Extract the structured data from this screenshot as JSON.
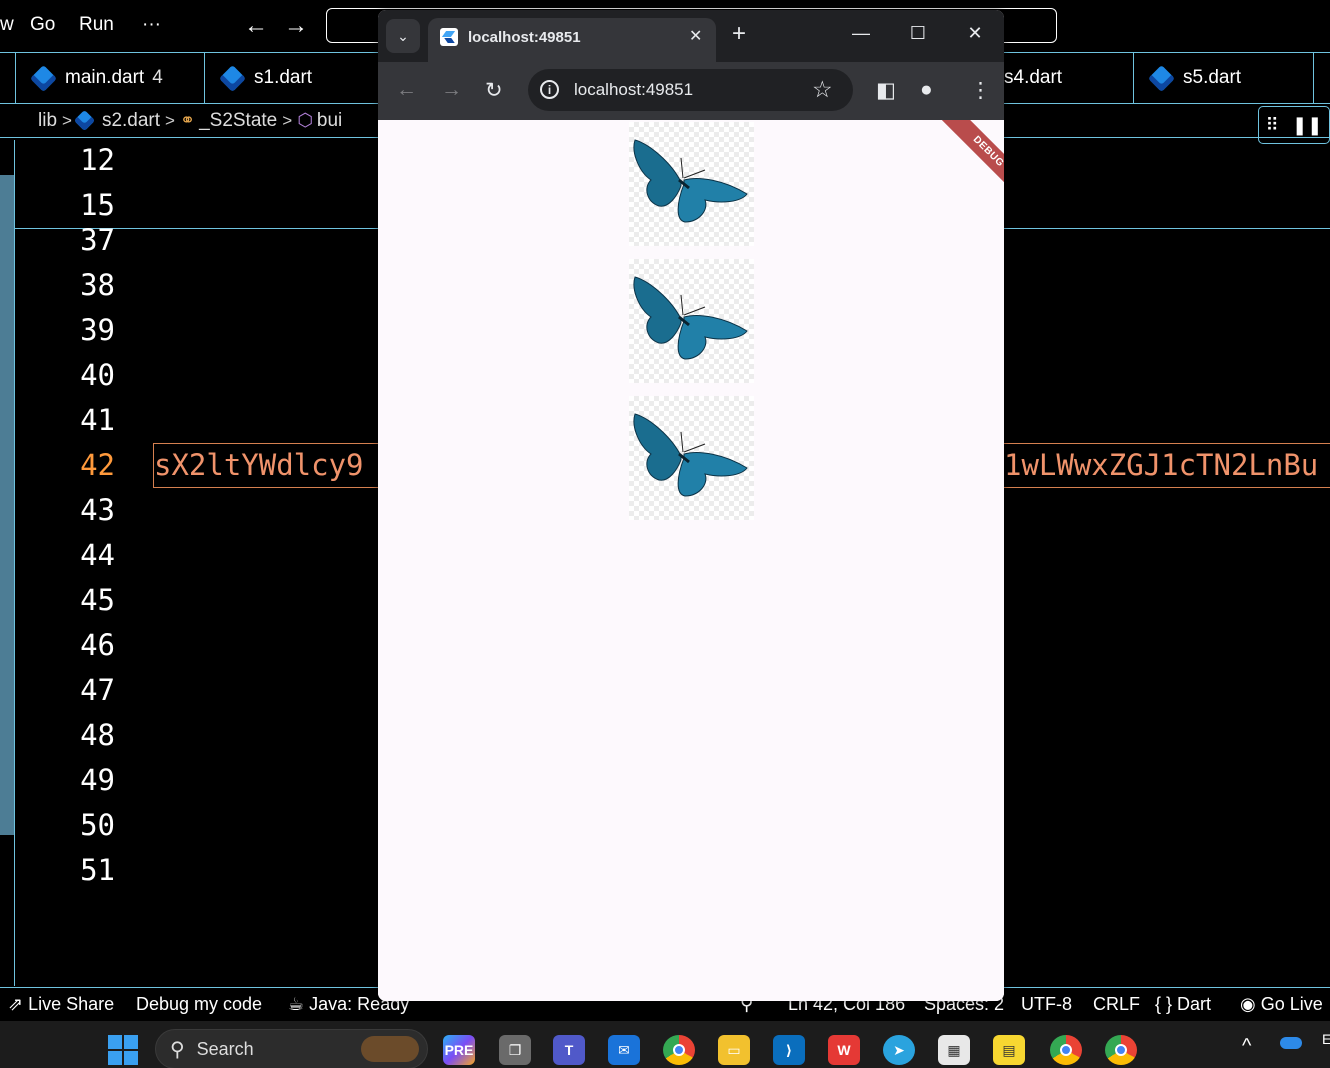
{
  "menubar": {
    "edge_letter": "w",
    "items": [
      "Go",
      "Run",
      "···"
    ],
    "back_arrow": "←",
    "forward_arrow": "→"
  },
  "tabs": [
    {
      "label": "main.dart",
      "badge": "4"
    },
    {
      "label": "s1.dart"
    },
    {
      "label": "s4.dart"
    },
    {
      "label": "s5.dart"
    }
  ],
  "breadcrumb": {
    "items": [
      "lib",
      "s2.dart",
      "_S2State",
      "bui"
    ]
  },
  "editor": {
    "sticky_lines": [
      "12",
      "15"
    ],
    "line_numbers": [
      "37",
      "38",
      "39",
      "40",
      "41",
      "42",
      "43",
      "44",
      "45",
      "46",
      "47",
      "48",
      "49",
      "50",
      "51"
    ],
    "active_line": "42",
    "code_left": "sX2ltYWdlcy9",
    "code_right": "1wLWwxZGJ1cTN2LnBu"
  },
  "statusbar": {
    "live_share": "Live Share",
    "debug": "Debug my code",
    "java": "Java: Ready",
    "position": "Ln 42, Col 186",
    "spaces": "Spaces: 2",
    "encoding": "UTF-8",
    "eol": "CRLF",
    "language": "Dart",
    "go_live": "Go Live"
  },
  "taskbar": {
    "search_placeholder": "Search",
    "icons": [
      "copilot-icon",
      "task-view-icon",
      "teams-icon",
      "mail-icon",
      "chrome-icon",
      "file-explorer-icon",
      "vscode-icon",
      "wps-office-icon",
      "telegram-icon",
      "microsoft-store-icon",
      "sticky-notes-icon",
      "chrome-badged-icon",
      "chrome-active-icon"
    ],
    "tray_chevron": "^",
    "edge_letter": "E"
  },
  "browser": {
    "tab_title": "localhost:49851",
    "url": "localhost:49851",
    "debug_banner": "DEBUG",
    "images": [
      {
        "name": "butterfly-image-1"
      },
      {
        "name": "butterfly-image-2"
      },
      {
        "name": "butterfly-image-3"
      }
    ]
  },
  "colors": {
    "accent_border": "#6fc3df",
    "active_line_number": "#ff9a3c",
    "string_text": "#f0936b",
    "debug_banner": "#b94c4c",
    "butterfly": "#1a6d8f"
  }
}
